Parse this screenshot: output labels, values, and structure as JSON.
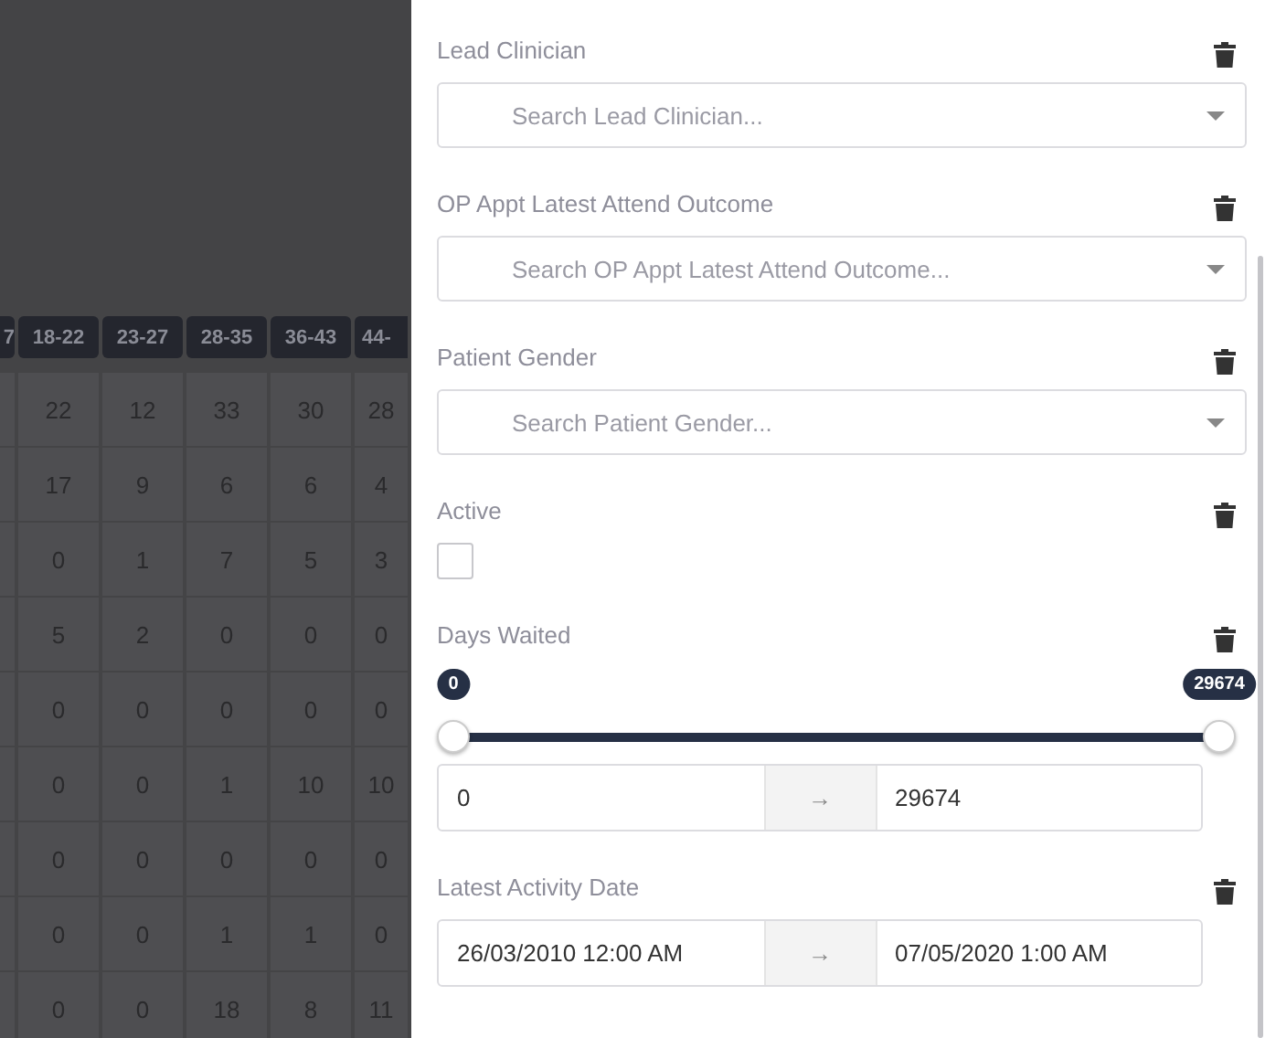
{
  "background_table": {
    "columns": [
      "7",
      "18-22",
      "23-27",
      "28-35",
      "36-43",
      "44-"
    ],
    "rows": [
      [
        "",
        "22",
        "12",
        "33",
        "30",
        "28"
      ],
      [
        "",
        "17",
        "9",
        "6",
        "6",
        "4"
      ],
      [
        "",
        "0",
        "1",
        "7",
        "5",
        "3"
      ],
      [
        "",
        "5",
        "2",
        "0",
        "0",
        "0"
      ],
      [
        "",
        "0",
        "0",
        "0",
        "0",
        "0"
      ],
      [
        "",
        "0",
        "0",
        "1",
        "10",
        "10"
      ],
      [
        "",
        "0",
        "0",
        "0",
        "0",
        "0"
      ],
      [
        "",
        "0",
        "0",
        "1",
        "1",
        "0"
      ],
      [
        "",
        "0",
        "0",
        "18",
        "8",
        "11"
      ]
    ]
  },
  "filter_panel": {
    "filters": [
      {
        "kind": "dropdown",
        "label": "Lead Clinician",
        "placeholder": "Search Lead Clinician..."
      },
      {
        "kind": "dropdown",
        "label": "OP Appt Latest Attend Outcome",
        "placeholder": "Search OP Appt Latest Attend Outcome..."
      },
      {
        "kind": "dropdown",
        "label": "Patient Gender",
        "placeholder": "Search Patient Gender..."
      },
      {
        "kind": "checkbox",
        "label": "Active",
        "checked": false
      },
      {
        "kind": "range_slider",
        "label": "Days Waited",
        "thumbs": [
          {
            "bubble": "0",
            "level": 0
          },
          {
            "bubble": "29674",
            "level": 1
          }
        ],
        "from": "0",
        "separator": "→",
        "to": "29674"
      },
      {
        "kind": "date_range",
        "label": "Latest Activity Date",
        "from": "26/03/2010 12:00 AM",
        "separator": "→",
        "to": "07/05/2020 1:00 AM"
      }
    ]
  }
}
